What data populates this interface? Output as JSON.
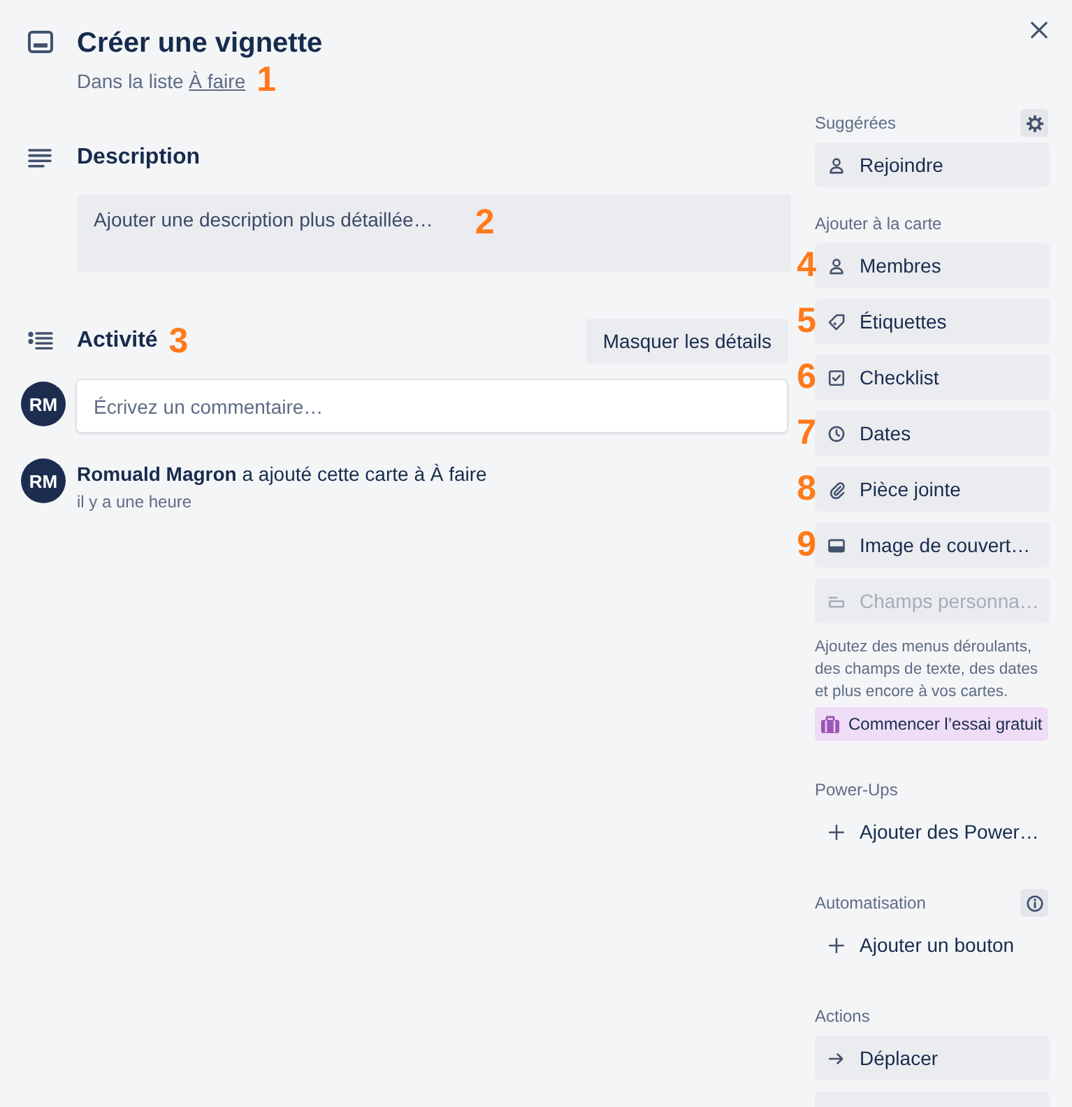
{
  "card": {
    "title": "Créer une vignette",
    "list_prefix": "Dans la liste",
    "list_name": "À faire",
    "marker": "1"
  },
  "description": {
    "heading": "Description",
    "placeholder": "Ajouter une description plus détaillée…",
    "marker": "2"
  },
  "activity": {
    "heading": "Activité",
    "marker": "3",
    "toggle_button": "Masquer les détails",
    "comment": {
      "avatar": "RM",
      "placeholder": "Écrivez un commentaire…"
    },
    "entries": [
      {
        "avatar": "RM",
        "text": "**Romuald Magron** a ajouté cette carte à À faire",
        "time": "il y a une heure"
      }
    ]
  },
  "sidebar": {
    "sections": [
      {
        "title": "Suggérées",
        "header_button": {
          "kind": "settings"
        },
        "buttons": [
          {
            "kind": "join",
            "label": "Rejoindre",
            "disabled": false
          }
        ]
      },
      {
        "title": "Ajouter à la carte",
        "buttons": [
          {
            "kind": "members",
            "label": "Membres",
            "disabled": false,
            "marker": "4"
          },
          {
            "kind": "labels",
            "label": "Étiquettes",
            "disabled": false,
            "marker": "5"
          },
          {
            "kind": "checklist",
            "label": "Checklist",
            "disabled": false,
            "marker": "6"
          },
          {
            "kind": "dates",
            "label": "Dates",
            "disabled": false,
            "marker": "7"
          },
          {
            "kind": "attachment",
            "label": "Pièce jointe",
            "disabled": false,
            "marker": "8"
          },
          {
            "kind": "cover",
            "label": "Image de couvert…",
            "disabled": false,
            "marker": "9"
          },
          {
            "kind": "fields",
            "label": "Champs personna…",
            "disabled": true
          }
        ],
        "note": "Ajoutez des menus déroulants, des champs de texte, des dates et plus encore à vos cartes.",
        "promo": "Commencer l’essai gratuit"
      },
      {
        "title": "Power-Ups",
        "buttons": [
          {
            "kind": "add",
            "label": "Ajouter des Power…",
            "disabled": false
          }
        ]
      },
      {
        "title": "Automatisation",
        "header_button": {
          "kind": "info"
        },
        "buttons": [
          {
            "kind": "add",
            "label": "Ajouter un bouton",
            "disabled": false
          }
        ]
      },
      {
        "title": "Actions",
        "buttons": [
          {
            "kind": "move",
            "label": "Déplacer",
            "disabled": false
          },
          {
            "kind": "blank"
          }
        ]
      }
    ]
  }
}
